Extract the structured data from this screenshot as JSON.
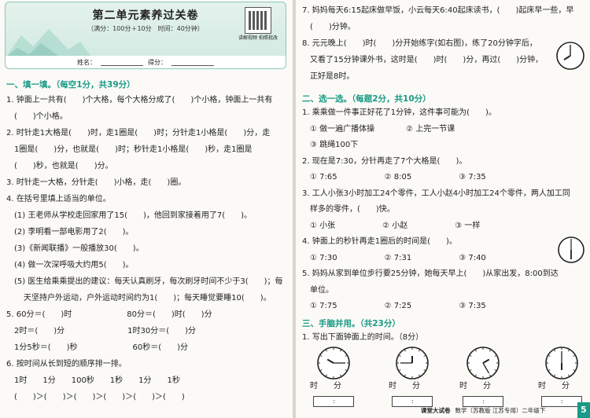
{
  "header": {
    "title": "第二单元素养过关卷",
    "subtitle": "（满分：100分＋10分　时间：40分钟）",
    "qr_label": "讲解视频 拍照批改",
    "name_label": "姓名：",
    "score_label": "得分："
  },
  "left": {
    "sec1": "一、填一填。（每空1分，共39分）",
    "lines": [
      "1. 钟面上一共有(　　)个大格，每个大格分成了(　　)个小格，钟面上一共有",
      "(　　)个小格。",
      "2. 时针走1大格是(　　)时，走1圈是(　　)时；分针走1小格是(　　)分，走",
      "1圈是(　　)分，也就是(　　)时；秒针走1小格是(　　)秒，走1圈是",
      "(　　)秒，也就是(　　)分。",
      "3. 时针走一大格，分针走(　　)小格，走(　　)圈。",
      "4. 在括号里填上适当的单位。",
      "(1) 王老师从学校走回家用了15(　　)，他回到家接着用了7(　　)。",
      "(2) 李明看一部电影用了2(　　)。",
      "(3)《新闻联播》一般播放30(　　)。",
      "(4) 做一次深呼吸大约用5(　　)。",
      "(5) 医生给乘乘提出的建议：每天认真刷牙，每次刷牙时间不少于3(　　)；每",
      "天坚持户外运动，户外运动时间约为1(　　)；每天睡觉要睡10(　　)。",
      "5. 60分＝(　　)时　　　　　　　80分＝(　　)时(　　)分",
      "2时＝(　　)分　　　　　　　　1时30分＝(　　)分",
      "1分5秒＝(　　)秒　　　　　　　60秒＝(　　)分",
      "6. 按时间从长到短的顺序排一排。",
      "1时　　1分　　100秒　　1秒　　1分　　1秒",
      "(　　)＞(　　)＞(　　)＞(　　)＞(　　)＞(　　)"
    ]
  },
  "right": {
    "top_lines": [
      "7. 妈妈每天6:15起床做早饭，小云每天6:40起床读书，(　　)起床早一些，早",
      "(　　)分钟。",
      "8. 元元晚上(　　)时(　　)分开始练字(如右图)，练了20分钟字后，",
      "又看了15分钟课外书，这时是(　　)时(　　)分，再过(　　)分钟，",
      "正好是8时。"
    ],
    "sec2": "二、选一选。（每题2分，共10分）",
    "choice_lines": [
      "1. 乘乘做一件事正好花了1分钟，这件事可能为(　　)。",
      "① 做一遍广播体操　　　　② 上完一节课",
      "③ 跳绳100下",
      "2. 现在是7:30，分针再走了7个大格是(　　)。",
      "① 7:65　　　　　　② 8:05　　　　　　③ 7:35",
      "3. 工人小张3小时加工24个零件，工人小赵4小时加工24个零件，两人加工同",
      "样多的零件，(　　)快。",
      "① 小张　　　　　　② 小赵　　　　　　③ 一样",
      "4. 钟面上的秒针再走1圈后的时间是(　　)。",
      "① 7:30　　　　　　② 7:31　　　　　　③ 7:40",
      "5. 妈妈从家到单位步行要25分钟，她每天早上(　　)从家出发，8:00到达",
      "单位。",
      "① 7:75　　　　　　② 7:25　　　　　　③ 7:35"
    ],
    "sec3": "三、手脑并用。（共23分）",
    "q3_1": "1. 写出下面钟面上的时间。（8分）",
    "clock_label_hour": "时",
    "clock_label_min": "分",
    "colon": ":"
  },
  "footer": {
    "brand": "课堂大试卷",
    "subject": "数学（苏教版 江苏专用）二年级下",
    "page": "5"
  }
}
